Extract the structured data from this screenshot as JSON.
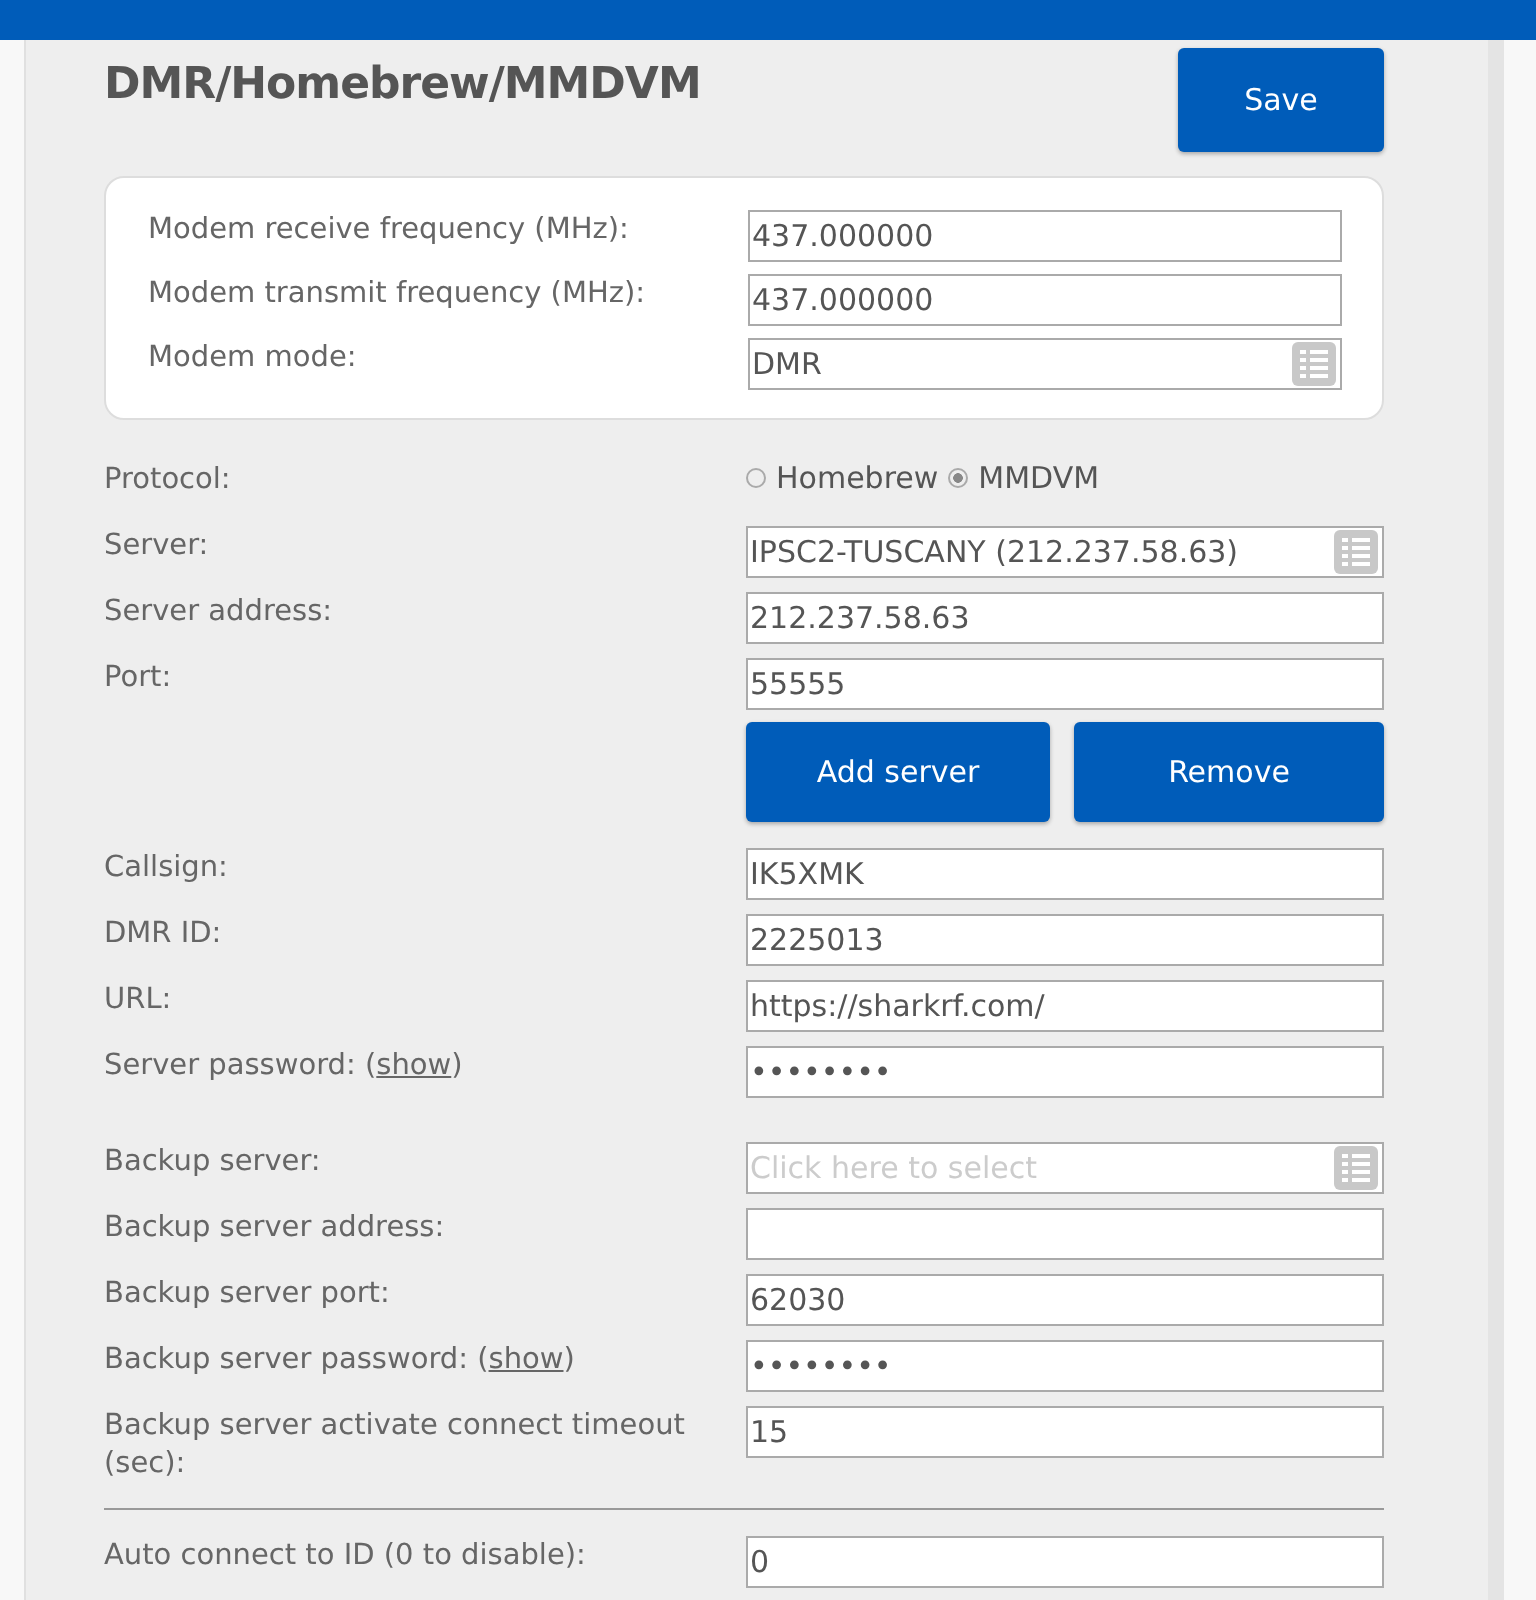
{
  "title": "DMR/Homebrew/MMDVM",
  "save_button": "Save",
  "modem_fields": [
    {
      "label": "Modem receive frequency (MHz):",
      "kind": "text",
      "value": "437.000000"
    },
    {
      "label": "Modem transmit frequency (MHz):",
      "kind": "text",
      "value": "437.000000"
    },
    {
      "label": "Modem mode:",
      "kind": "select",
      "value": "DMR"
    }
  ],
  "fields": [
    {
      "kind": "radio",
      "label": "Protocol:",
      "options": [
        {
          "label": "Homebrew",
          "selected": false
        },
        {
          "label": "MMDVM",
          "selected": true
        }
      ]
    },
    {
      "kind": "select",
      "label": "Server:",
      "value": "IPSC2-TUSCANY (212.237.58.63)"
    },
    {
      "kind": "text",
      "label": "Server address:",
      "value": "212.237.58.63"
    },
    {
      "kind": "text",
      "label": "Port:",
      "value": "55555"
    },
    {
      "kind": "buttons",
      "buttons": [
        "Add server",
        "Remove"
      ]
    },
    {
      "kind": "text",
      "label": "Callsign:",
      "value": "IK5XMK"
    },
    {
      "kind": "text",
      "label": "DMR ID:",
      "value": "2225013"
    },
    {
      "kind": "text",
      "label": "URL:",
      "value": "https://sharkrf.com/"
    },
    {
      "kind": "password",
      "label": "Server password: (",
      "link": "show",
      "label_end": ")",
      "value": "••••••••"
    },
    {
      "kind": "spacer"
    },
    {
      "kind": "select",
      "label": "Backup server:",
      "placeholder": "Click here to select"
    },
    {
      "kind": "text",
      "label": "Backup server address:"
    },
    {
      "kind": "text",
      "label": "Backup server port:",
      "value": "62030"
    },
    {
      "kind": "password",
      "label": "Backup server password: (",
      "link": "show",
      "label_end": ")",
      "value": "••••••••"
    },
    {
      "kind": "text",
      "label": "Backup server activate connect timeout (sec):",
      "value": "15"
    },
    {
      "kind": "divider"
    },
    {
      "kind": "text",
      "label": "Auto connect to ID (0 to disable):",
      "value": "0"
    }
  ]
}
